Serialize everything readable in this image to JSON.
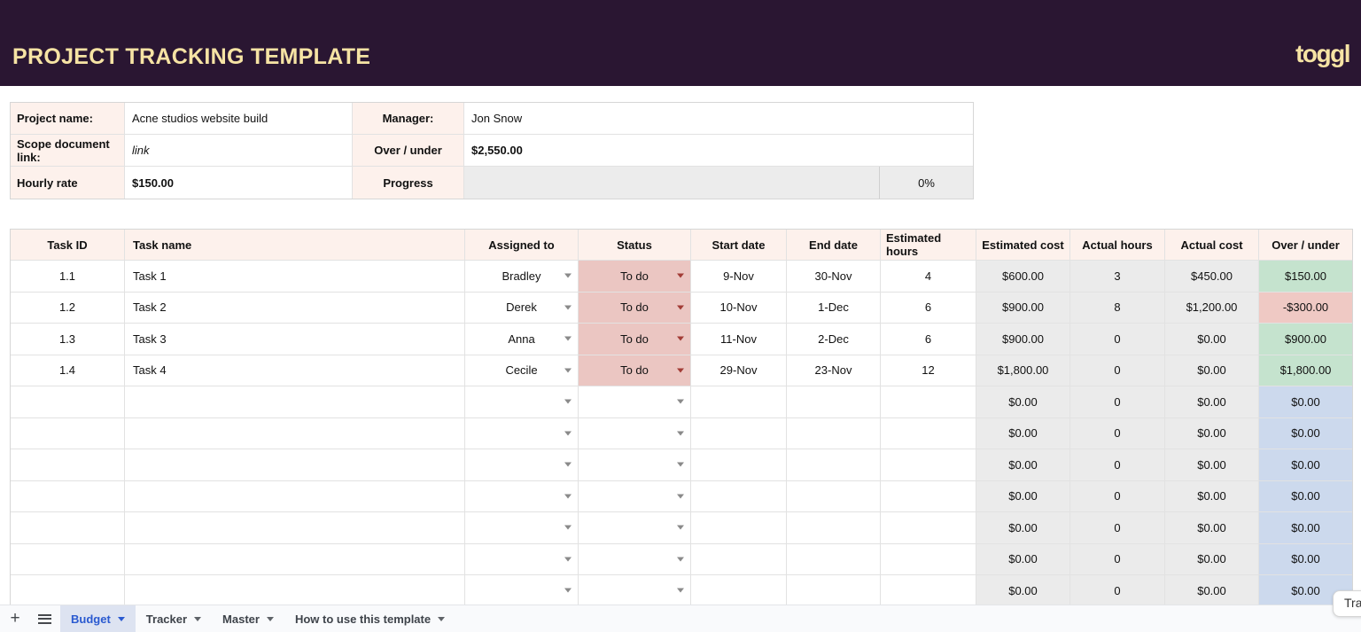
{
  "header": {
    "title": "PROJECT TRACKING TEMPLATE",
    "logo_text": "toggl"
  },
  "info": {
    "project_name_label": "Project name:",
    "project_name": "Acne studios website build",
    "manager_label": "Manager:",
    "manager": "Jon Snow",
    "scope_label": "Scope document link:",
    "scope_value": "link",
    "over_under_label": "Over / under",
    "over_under_value": "$2,550.00",
    "hourly_rate_label": "Hourly rate",
    "hourly_rate": "$150.00",
    "progress_label": "Progress",
    "progress_percent": "0%"
  },
  "task_table": {
    "columns": [
      "Task ID",
      "Task name",
      "Assigned to",
      "Status",
      "Start date",
      "End date",
      "Estimated hours",
      "Estimated cost",
      "Actual hours",
      "Actual cost",
      "Over / under"
    ],
    "rows": [
      {
        "id": "1.1",
        "name": "Task 1",
        "assigned": "Bradley",
        "status": "To do",
        "start": "9-Nov",
        "end": "30-Nov",
        "est_hours": "4",
        "est_cost": "$600.00",
        "act_hours": "3",
        "act_cost": "$450.00",
        "over_under": "$150.00",
        "over_state": "positive"
      },
      {
        "id": "1.2",
        "name": "Task 2",
        "assigned": "Derek",
        "status": "To do",
        "start": "10-Nov",
        "end": "1-Dec",
        "est_hours": "6",
        "est_cost": "$900.00",
        "act_hours": "8",
        "act_cost": "$1,200.00",
        "over_under": "-$300.00",
        "over_state": "negative"
      },
      {
        "id": "1.3",
        "name": "Task 3",
        "assigned": "Anna",
        "status": "To do",
        "start": "11-Nov",
        "end": "2-Dec",
        "est_hours": "6",
        "est_cost": "$900.00",
        "act_hours": "0",
        "act_cost": "$0.00",
        "over_under": "$900.00",
        "over_state": "positive"
      },
      {
        "id": "1.4",
        "name": "Task 4",
        "assigned": "Cecile",
        "status": "To do",
        "start": "29-Nov",
        "end": "23-Nov",
        "est_hours": "12",
        "est_cost": "$1,800.00",
        "act_hours": "0",
        "act_cost": "$0.00",
        "over_under": "$1,800.00",
        "over_state": "positive"
      },
      {
        "id": "",
        "name": "",
        "assigned": "",
        "status": "",
        "start": "",
        "end": "",
        "est_hours": "",
        "est_cost": "$0.00",
        "act_hours": "0",
        "act_cost": "$0.00",
        "over_under": "$0.00",
        "over_state": "neutral"
      },
      {
        "id": "",
        "name": "",
        "assigned": "",
        "status": "",
        "start": "",
        "end": "",
        "est_hours": "",
        "est_cost": "$0.00",
        "act_hours": "0",
        "act_cost": "$0.00",
        "over_under": "$0.00",
        "over_state": "neutral"
      },
      {
        "id": "",
        "name": "",
        "assigned": "",
        "status": "",
        "start": "",
        "end": "",
        "est_hours": "",
        "est_cost": "$0.00",
        "act_hours": "0",
        "act_cost": "$0.00",
        "over_under": "$0.00",
        "over_state": "neutral"
      },
      {
        "id": "",
        "name": "",
        "assigned": "",
        "status": "",
        "start": "",
        "end": "",
        "est_hours": "",
        "est_cost": "$0.00",
        "act_hours": "0",
        "act_cost": "$0.00",
        "over_under": "$0.00",
        "over_state": "neutral"
      },
      {
        "id": "",
        "name": "",
        "assigned": "",
        "status": "",
        "start": "",
        "end": "",
        "est_hours": "",
        "est_cost": "$0.00",
        "act_hours": "0",
        "act_cost": "$0.00",
        "over_under": "$0.00",
        "over_state": "neutral"
      },
      {
        "id": "",
        "name": "",
        "assigned": "",
        "status": "",
        "start": "",
        "end": "",
        "est_hours": "",
        "est_cost": "$0.00",
        "act_hours": "0",
        "act_cost": "$0.00",
        "over_under": "$0.00",
        "over_state": "neutral"
      },
      {
        "id": "",
        "name": "",
        "assigned": "",
        "status": "",
        "start": "",
        "end": "",
        "est_hours": "",
        "est_cost": "$0.00",
        "act_hours": "0",
        "act_cost": "$0.00",
        "over_under": "$0.00",
        "over_state": "neutral"
      }
    ]
  },
  "footer": {
    "add_glyph": "+",
    "tabs": [
      {
        "label": "Budget",
        "active": true
      },
      {
        "label": "Tracker",
        "active": false
      },
      {
        "label": "Master",
        "active": false
      },
      {
        "label": "How to use this template",
        "active": false
      }
    ],
    "tooltip_text": "Tra"
  },
  "colors": {
    "banner_bg": "#2a1632",
    "banner_text": "#f6e3a4",
    "label_bg": "#fdf1ec",
    "status_todo_bg": "#ebc6c2",
    "positive_bg": "#c5e3ce",
    "negative_bg": "#efc9c4",
    "neutral_bg": "#ccd9ed",
    "calc_bg": "#ebebeb",
    "active_tab_bg": "#dde3f1",
    "active_tab_text": "#2a5ad0"
  }
}
